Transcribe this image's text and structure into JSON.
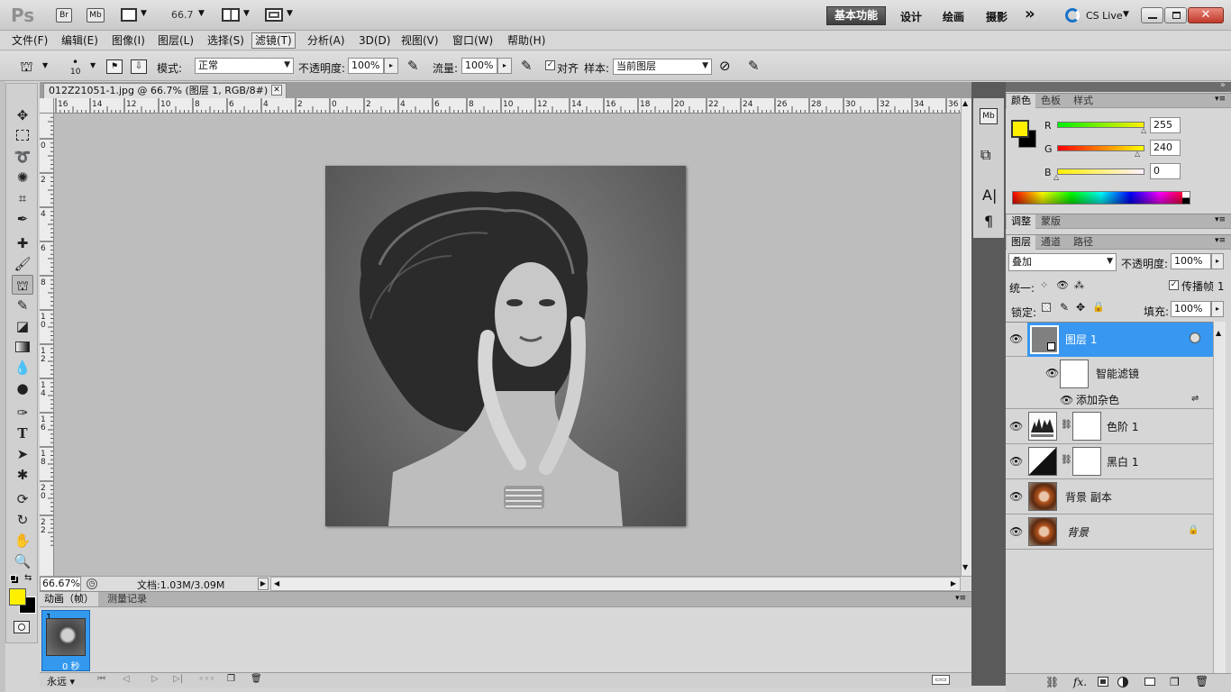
{
  "app": {
    "logo": "Ps",
    "zoom": "66.7",
    "workspaces": [
      "基本功能",
      "设计",
      "绘画",
      "摄影"
    ],
    "workspace_more": "»",
    "cslive": "CS Live"
  },
  "menu": [
    "文件(F)",
    "编辑(E)",
    "图像(I)",
    "图层(L)",
    "选择(S)",
    "滤镜(T)",
    "分析(A)",
    "3D(D)",
    "视图(V)",
    "窗口(W)",
    "帮助(H)"
  ],
  "options": {
    "brush_size": "10",
    "mode_label": "模式:",
    "mode_value": "正常",
    "opacity_label": "不透明度:",
    "opacity_value": "100%",
    "flow_label": "流量:",
    "flow_value": "100%",
    "aligned_label": "对齐",
    "sample_label": "样本:",
    "sample_value": "当前图层"
  },
  "document": {
    "tab_title": "012Z21051-1.jpg @ 66.7% (图层 1, RGB/8#) *",
    "ruler_h": [
      "16",
      "14",
      "12",
      "10",
      "8",
      "6",
      "4",
      "2",
      "0",
      "2",
      "4",
      "6",
      "8",
      "10",
      "12",
      "14",
      "16",
      "18",
      "20",
      "22",
      "24",
      "26",
      "28",
      "30",
      "32",
      "34",
      "36"
    ],
    "ruler_v": [
      "2",
      "0",
      "2",
      "4",
      "6",
      "8",
      "1 0",
      "1 2",
      "1 4",
      "1 6",
      "1 8",
      "2 0",
      "2 2"
    ],
    "zoom_pct": "66.67%",
    "doc_size": "文档:1.03M/3.09M"
  },
  "animation": {
    "tabs": [
      "动画（帧）",
      "测量记录"
    ],
    "frame_number": "1",
    "frame_delay": "0 秒",
    "loop": "永远"
  },
  "color_panel": {
    "tabs": [
      "颜色",
      "色板",
      "样式"
    ],
    "r_label": "R",
    "r_value": "255",
    "g_label": "G",
    "g_value": "240",
    "b_label": "B",
    "b_value": "0",
    "fg_color": "#fff000",
    "bg_color": "#000000"
  },
  "adjust_panel": {
    "tabs": [
      "调整",
      "蒙版"
    ]
  },
  "layers_panel": {
    "tabs": [
      "图层",
      "通道",
      "路径"
    ],
    "blend_mode": "叠加",
    "opacity_label": "不透明度:",
    "opacity_value": "100%",
    "unify_label": "统一:",
    "propagate_label": "传播帧 1",
    "lock_label": "锁定:",
    "fill_label": "填充:",
    "fill_value": "100%",
    "layers": [
      {
        "name": "图层 1"
      },
      {
        "name": "智能滤镜"
      },
      {
        "name": "添加杂色"
      },
      {
        "name": "色阶 1"
      },
      {
        "name": "黑白 1"
      },
      {
        "name": "背景 副本"
      },
      {
        "name": "背景"
      }
    ]
  }
}
